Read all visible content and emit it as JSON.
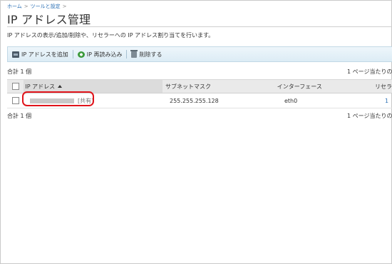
{
  "breadcrumb": {
    "home": "ホーム",
    "sep1": ">",
    "tools": "ツールと設定",
    "sep2": ">"
  },
  "page": {
    "title": "IP アドレス管理",
    "description": "IP アドレスの表示/追加/削除や、リセラーへの IP アドレス割り当てを行います。"
  },
  "toolbar": {
    "add_label": "IP アドレスを追加",
    "reload_label": "IP 再読み込み",
    "delete_label": "削除する"
  },
  "summary": {
    "total_top": "合計 1 個",
    "per_page_top": "1 ページ当たりの",
    "total_bottom": "合計 1 個",
    "per_page_bottom": "1 ページ当たりの"
  },
  "table": {
    "headers": {
      "ip": "IP アドレス",
      "subnet": "サブネットマスク",
      "interface": "インターフェース",
      "reseller": "リセラ"
    },
    "rows": [
      {
        "ip_tag": "[共有]",
        "subnet": "255.255.255.128",
        "interface": "eth0",
        "reseller": "1"
      }
    ]
  },
  "colors": {
    "link": "#2a6fb5",
    "highlight": "#e0141b",
    "toolbar_bg": "#dcecf5"
  }
}
